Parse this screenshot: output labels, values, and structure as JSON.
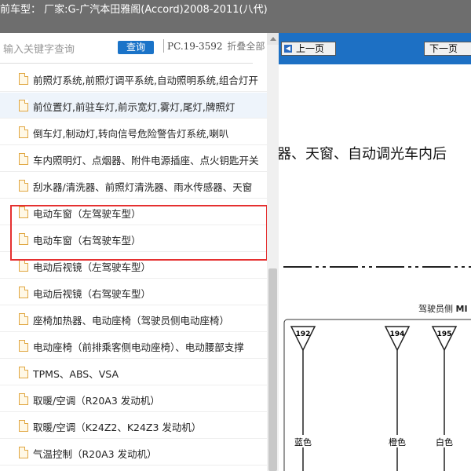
{
  "titlebar": {
    "text": "前车型： 厂家:G-广汽本田雅阁(Accord)2008-2011(八代)"
  },
  "search": {
    "placeholder": "输入关键字查询",
    "button_label": "查询",
    "pc_code": "PC.19-3592",
    "fold_label": "折叠全部"
  },
  "list": {
    "items": [
      {
        "label": "前照灯系统,前照灯调平系统,自动照明系统,组合灯开"
      },
      {
        "label": "前位置灯,前驻车灯,前示宽灯,雾灯,尾灯,牌照灯"
      },
      {
        "label": "倒车灯,制动灯,转向信号危险警告灯系统,喇叭"
      },
      {
        "label": "车内照明灯、点烟器、附件电源插座、点火钥匙开关"
      },
      {
        "label": "刮水器/清洗器、前照灯清洗器、雨水传感器、天窗"
      },
      {
        "label": "电动车窗（左驾驶车型）"
      },
      {
        "label": "电动车窗（右驾驶车型）"
      },
      {
        "label": "电动后视镜（左驾驶车型）"
      },
      {
        "label": "电动后视镜（右驾驶车型）"
      },
      {
        "label": "座椅加热器、电动座椅（驾驶员侧电动座椅）"
      },
      {
        "label": "电动座椅（前排乘客侧电动座椅）、电动腰部支撑"
      },
      {
        "label": "TPMS、ABS、VSA"
      },
      {
        "label": "取暖/空调（R20A3 发动机）"
      },
      {
        "label": "取暖/空调（K24Z2、K24Z3 发动机）"
      },
      {
        "label": "气温控制（R20A3 发动机）"
      }
    ],
    "highlighted_index": 1,
    "annotated_range": [
      4,
      5
    ]
  },
  "viewer": {
    "prev_label": "上一页",
    "next_label": "下一页",
    "heading": "器、天窗、自动调光车内后",
    "driver_side_label": "驾驶员侧",
    "driver_side_code": "MI",
    "connectors": [
      {
        "id": "192",
        "wire_color": "蓝色"
      },
      {
        "id": "194",
        "wire_color": "橙色"
      },
      {
        "id": "195",
        "wire_color": "白色"
      }
    ]
  },
  "colors": {
    "titlebar": "#6e6e6e",
    "nav_blue": "#1d70c4",
    "query_btn": "#1a73c8",
    "annotation_red": "#e53030"
  }
}
